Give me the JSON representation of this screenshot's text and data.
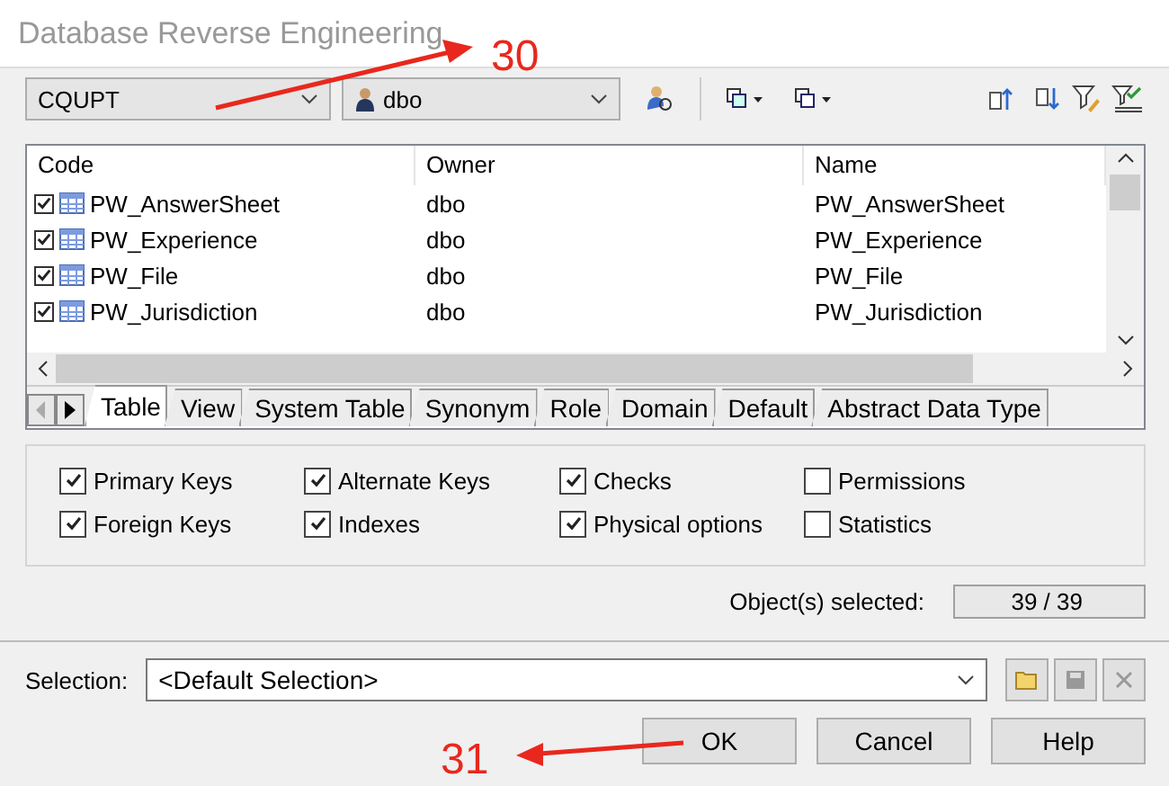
{
  "window": {
    "title": "Database Reverse Engineering"
  },
  "toolbar": {
    "database": "CQUPT",
    "owner": "dbo"
  },
  "table": {
    "columns": [
      "Code",
      "Owner",
      "Name"
    ],
    "rows": [
      {
        "code": "PW_AnswerSheet",
        "owner": "dbo",
        "name": "PW_AnswerSheet",
        "checked": true
      },
      {
        "code": "PW_Experience",
        "owner": "dbo",
        "name": "PW_Experience",
        "checked": true
      },
      {
        "code": "PW_File",
        "owner": "dbo",
        "name": "PW_File",
        "checked": true
      },
      {
        "code": "PW_Jurisdiction",
        "owner": "dbo",
        "name": "PW_Jurisdiction",
        "checked": true
      }
    ]
  },
  "tabs": [
    {
      "label": "Table",
      "selected": true
    },
    {
      "label": "View",
      "selected": false
    },
    {
      "label": "System Table",
      "selected": false
    },
    {
      "label": "Synonym",
      "selected": false
    },
    {
      "label": "Role",
      "selected": false
    },
    {
      "label": "Domain",
      "selected": false
    },
    {
      "label": "Default",
      "selected": false
    },
    {
      "label": "Abstract Data Type",
      "selected": false
    }
  ],
  "options": [
    {
      "label": "Primary Keys",
      "checked": true
    },
    {
      "label": "Alternate Keys",
      "checked": true
    },
    {
      "label": "Checks",
      "checked": true
    },
    {
      "label": "Permissions",
      "checked": false
    },
    {
      "label": "Foreign Keys",
      "checked": true
    },
    {
      "label": "Indexes",
      "checked": true
    },
    {
      "label": "Physical options",
      "checked": true
    },
    {
      "label": "Statistics",
      "checked": false
    }
  ],
  "objects_selected": {
    "label": "Object(s) selected:",
    "value": "39 / 39"
  },
  "selection": {
    "label": "Selection:",
    "value": "<Default Selection>"
  },
  "buttons": [
    "OK",
    "Cancel",
    "Help"
  ],
  "annotations": [
    {
      "label": "30"
    },
    {
      "label": "31"
    }
  ]
}
